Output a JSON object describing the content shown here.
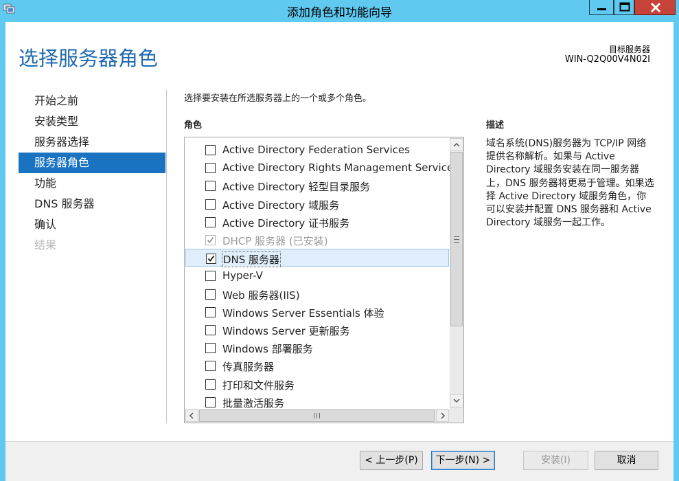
{
  "window": {
    "title": "添加角色和功能向导",
    "titlebar_color": "#5fc9f0",
    "close_color": "#c7433a"
  },
  "header": {
    "page_title": "选择服务器角色",
    "target_label": "目标服务器",
    "target_name": "WIN-Q2Q00V4N02I"
  },
  "nav": {
    "items": [
      {
        "label": "开始之前",
        "state": "normal"
      },
      {
        "label": "安装类型",
        "state": "normal"
      },
      {
        "label": "服务器选择",
        "state": "normal"
      },
      {
        "label": "服务器角色",
        "state": "active"
      },
      {
        "label": "功能",
        "state": "normal"
      },
      {
        "label": "DNS 服务器",
        "state": "normal"
      },
      {
        "label": "确认",
        "state": "normal"
      },
      {
        "label": "结果",
        "state": "disabled"
      }
    ],
    "active_color": "#1a73c0"
  },
  "main": {
    "instruction": "选择要安装在所选服务器上的一个或多个角色。",
    "roles_heading": "角色",
    "roles": [
      {
        "label": "Active Directory Federation Services",
        "checked": false,
        "disabled": false
      },
      {
        "label": "Active Directory Rights Management Services",
        "checked": false,
        "disabled": false
      },
      {
        "label": "Active Directory 轻型目录服务",
        "checked": false,
        "disabled": false
      },
      {
        "label": "Active Directory 域服务",
        "checked": false,
        "disabled": false
      },
      {
        "label": "Active Directory 证书服务",
        "checked": false,
        "disabled": false
      },
      {
        "label": "DHCP 服务器 (已安装)",
        "checked": true,
        "disabled": true
      },
      {
        "label": "DNS 服务器",
        "checked": true,
        "disabled": false,
        "selected": true
      },
      {
        "label": "Hyper-V",
        "checked": false,
        "disabled": false
      },
      {
        "label": "Web 服务器(IIS)",
        "checked": false,
        "disabled": false
      },
      {
        "label": "Windows Server Essentials 体验",
        "checked": false,
        "disabled": false
      },
      {
        "label": "Windows Server 更新服务",
        "checked": false,
        "disabled": false
      },
      {
        "label": "Windows 部署服务",
        "checked": false,
        "disabled": false
      },
      {
        "label": "传真服务器",
        "checked": false,
        "disabled": false
      },
      {
        "label": "打印和文件服务",
        "checked": false,
        "disabled": false
      },
      {
        "label": "批量激活服务",
        "checked": false,
        "disabled": false
      }
    ],
    "description_heading": "描述",
    "description": "域名系统(DNS)服务器为 TCP/IP 网络提供名称解析。如果与 Active Directory 域服务安装在同一服务器上，DNS 服务器将更易于管理。如果选择 Active Directory 域服务角色，你可以安装并配置 DNS 服务器和 Active Directory 域服务一起工作。"
  },
  "footer": {
    "prev_label": "< 上一步(P)",
    "next_label": "下一步(N) >",
    "install_label": "安装(I)",
    "cancel_label": "取消"
  }
}
